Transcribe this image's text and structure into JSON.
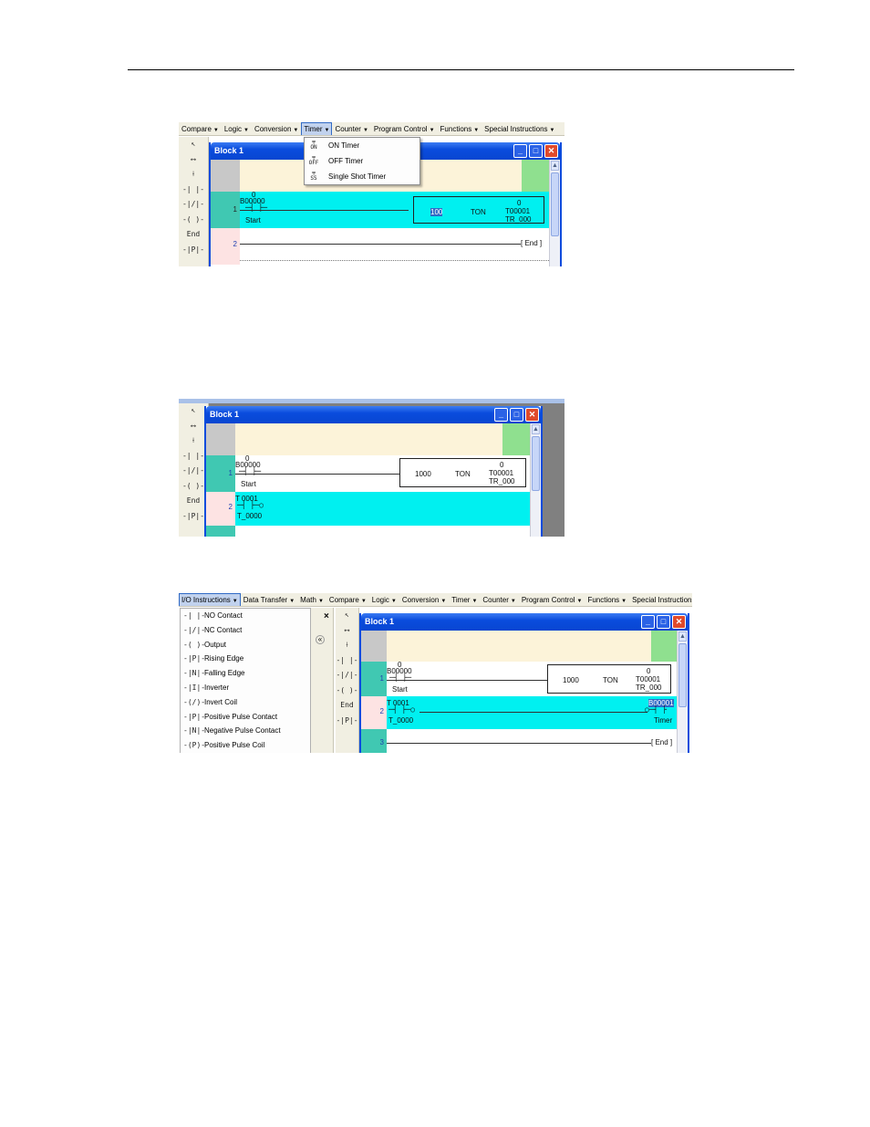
{
  "screens": {
    "s1": {
      "menubar": [
        "Compare",
        "Logic",
        "Conversion",
        "Timer",
        "Counter",
        "Program Control",
        "Functions",
        "Special Instructions"
      ],
      "active_menu": "Timer",
      "timer_menu": [
        {
          "label": "ON Timer",
          "icon": "ON"
        },
        {
          "label": "OFF Timer",
          "icon": "OFF"
        },
        {
          "label": "Single Shot Timer",
          "icon": "SS"
        }
      ],
      "window_title": "Block 1",
      "rung1": {
        "number": "1",
        "value": "0",
        "address": "B00000",
        "tag": "Start",
        "preset": "100",
        "instr": "TON",
        "acc": "0",
        "timer": "T00001",
        "timer_tag": "TR_000"
      },
      "rung2": {
        "number": "2",
        "end": "End"
      }
    },
    "s2": {
      "window_title": "Block 1",
      "rung1": {
        "number": "1",
        "value": "0",
        "address": "B00000",
        "tag": "Start",
        "preset": "1000",
        "instr": "TON",
        "acc": "0",
        "timer": "T00001",
        "timer_tag": "TR_000"
      },
      "rung2": {
        "number": "2",
        "address": "T 0001",
        "tag": "T_0000"
      }
    },
    "s3": {
      "menubar": [
        "I/O Instructions",
        "Data Transfer",
        "Math",
        "Compare",
        "Logic",
        "Conversion",
        "Timer",
        "Counter",
        "Program Control",
        "Functions",
        "Special Instructions"
      ],
      "active_menu": "I/O Instructions",
      "io_menu": [
        {
          "label": "NO Contact",
          "icon": "-| |-"
        },
        {
          "label": "NC Contact",
          "icon": "-|/|-"
        },
        {
          "label": "Output",
          "icon": "-( )-"
        },
        {
          "label": "Rising Edge",
          "icon": "-|P|-"
        },
        {
          "label": "Falling Edge",
          "icon": "-|N|-"
        },
        {
          "label": "Inverter",
          "icon": "-|I|-"
        },
        {
          "label": "Invert Coil",
          "icon": "-(/)-"
        },
        {
          "label": "Positive Pulse Contact",
          "icon": "-|P|-"
        },
        {
          "label": "Negative Pulse Contact",
          "icon": "-|N|-"
        },
        {
          "label": "Positive Pulse Coil",
          "icon": "-(P)-"
        }
      ],
      "close_glyph": "×",
      "window_title": "Block 1",
      "rung1": {
        "number": "1",
        "value": "0",
        "address": "B00000",
        "tag": "Start",
        "preset": "1000",
        "instr": "TON",
        "acc": "0",
        "timer": "T00001",
        "timer_tag": "TR_000"
      },
      "rung2": {
        "number": "2",
        "address": "T 0001",
        "tag": "T_0000",
        "coil_address": "B00001",
        "coil_tag": "Timer"
      },
      "rung3": {
        "number": "3",
        "end": "End"
      }
    }
  },
  "palette": [
    "↖",
    "⟷",
    "⟊",
    "-| |-",
    "-|/|-",
    "-( )-",
    "End",
    "-|P|-"
  ],
  "colors": {
    "cyan": "#00f0f0",
    "teal": "#40c8b2",
    "pink": "#fde3e3",
    "cream": "#fcf3d9",
    "green": "#8fe08f",
    "title": "#0a4cdd"
  }
}
